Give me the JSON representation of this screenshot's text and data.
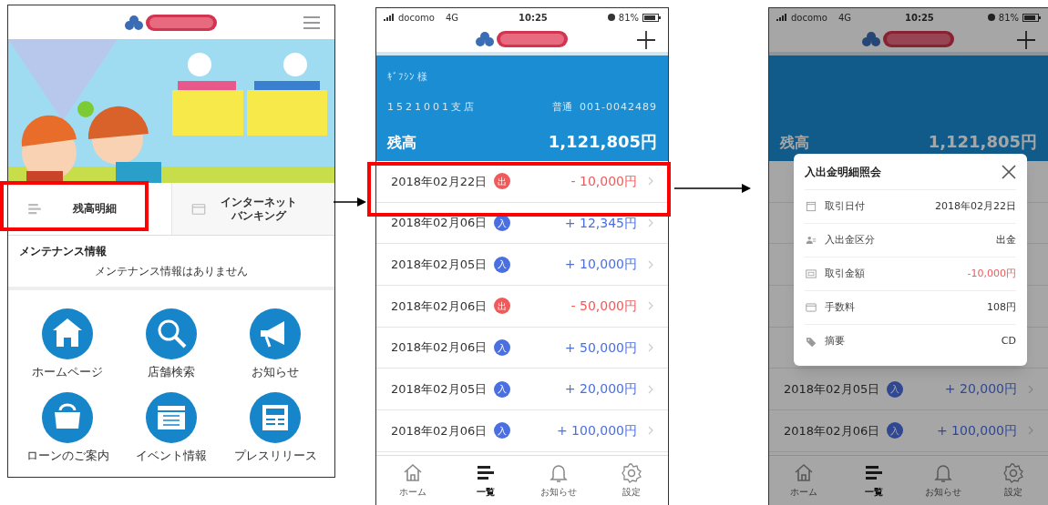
{
  "home_screen": {
    "shortcuts": [
      {
        "label": "残高明細",
        "kind": "list",
        "selected": true
      },
      {
        "label": "インターネットバンキング",
        "kind": "card",
        "selected": false
      }
    ],
    "maintenance": {
      "title": "メンテナンス情報",
      "message": "メンテナンス情報はありません"
    },
    "menu": [
      {
        "label": "ホームページ",
        "kind": "home"
      },
      {
        "label": "店舗検索",
        "kind": "search"
      },
      {
        "label": "お知らせ",
        "kind": "megaphone"
      },
      {
        "label": "ローンのご案内",
        "kind": "purse"
      },
      {
        "label": "イベント情報",
        "kind": "calendar"
      },
      {
        "label": "プレスリリース",
        "kind": "newspaper"
      }
    ]
  },
  "status_bar": {
    "carrier": "docomo",
    "network": "4G",
    "time": "10:25",
    "battery": "81%"
  },
  "account": {
    "name": "ｷﾞﾌｼﾝ 様",
    "branch": "1521001支店",
    "type": "普通",
    "number": "001-0042489",
    "balance_label": "残高",
    "balance": "1,121,805円"
  },
  "transactions": [
    {
      "date": "2018年02月22日",
      "kind": "withdrawal",
      "badge": "出",
      "amount": "- 10,000円"
    },
    {
      "date": "2018年02月06日",
      "kind": "deposit",
      "badge": "入",
      "amount": "+ 12,345円"
    },
    {
      "date": "2018年02月05日",
      "kind": "deposit",
      "badge": "入",
      "amount": "+ 10,000円"
    },
    {
      "date": "2018年02月06日",
      "kind": "withdrawal",
      "badge": "出",
      "amount": "- 50,000円"
    },
    {
      "date": "2018年02月06日",
      "kind": "deposit",
      "badge": "入",
      "amount": "+ 50,000円"
    },
    {
      "date": "2018年02月05日",
      "kind": "deposit",
      "badge": "入",
      "amount": "+ 20,000円"
    },
    {
      "date": "2018年02月06日",
      "kind": "deposit",
      "badge": "入",
      "amount": "+ 100,000円"
    }
  ],
  "tab_bar": [
    {
      "label": "ホーム",
      "kind": "home",
      "selected": false
    },
    {
      "label": "一覧",
      "kind": "list",
      "selected": true
    },
    {
      "label": "お知らせ",
      "kind": "bell",
      "selected": false
    },
    {
      "label": "設定",
      "kind": "gear",
      "selected": false
    }
  ],
  "detail_status_bar": {
    "carrier": "docomo",
    "network": "4G",
    "time": "10:25",
    "battery": "81%"
  },
  "detail_dialog": {
    "title": "入出金明細照会",
    "rows": [
      {
        "label": "取引日付",
        "value": "2018年02月22日",
        "kind": "calendar",
        "negative": false
      },
      {
        "label": "入出金区分",
        "value": "出金",
        "kind": "person",
        "negative": false
      },
      {
        "label": "取引金額",
        "value": "-10,000円",
        "kind": "money",
        "negative": true
      },
      {
        "label": "手数料",
        "value": "108円",
        "kind": "card",
        "negative": false
      },
      {
        "label": "摘要",
        "value": "CD",
        "kind": "tag",
        "negative": false
      }
    ]
  },
  "detail_background": {
    "balance_label": "残高",
    "balance": "1,121,805円",
    "visible_transactions": [
      {
        "date": "2018年02月05日",
        "kind": "deposit",
        "badge": "入",
        "amount": "+ 20,000円"
      },
      {
        "date": "2018年02月06日",
        "kind": "deposit",
        "badge": "入",
        "amount": "+ 100,000円"
      }
    ]
  },
  "detail_tab_bar": [
    {
      "label": "ホーム",
      "kind": "home",
      "selected": false
    },
    {
      "label": "一覧",
      "kind": "list",
      "selected": true
    },
    {
      "label": "お知らせ",
      "kind": "bell",
      "selected": false
    },
    {
      "label": "設定",
      "kind": "gear",
      "selected": false
    }
  ]
}
